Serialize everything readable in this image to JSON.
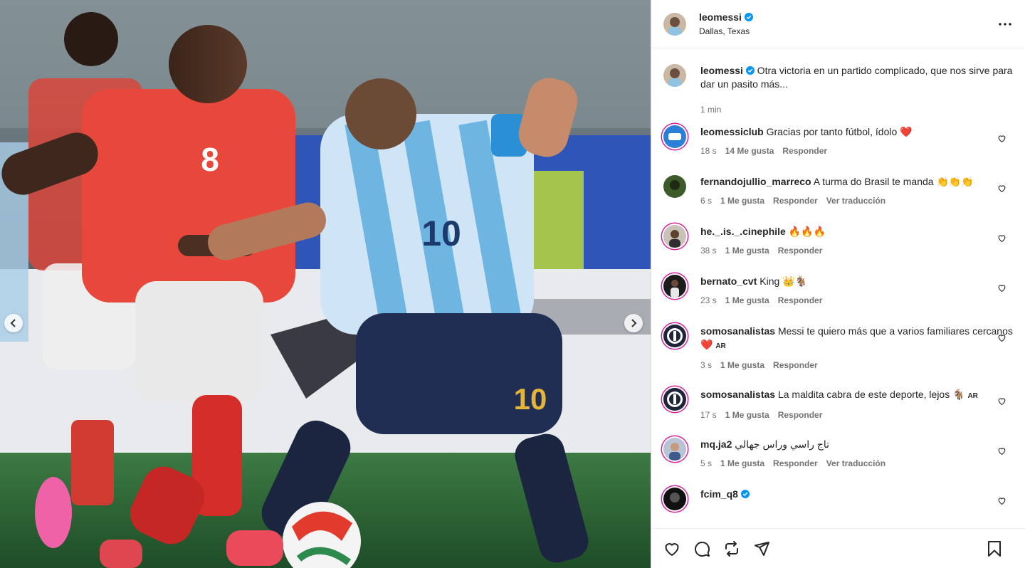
{
  "post": {
    "username": "leomessi",
    "location": "Dallas, Texas",
    "caption": "Otra victoria en un partido complicado, que nos sirve para dar un pasito más...",
    "time": "1 min"
  },
  "photo": {
    "jersey_number_left": "8",
    "jersey_number_right": "10",
    "shorts_number": "10"
  },
  "comments": [
    {
      "user": "leomessiclub",
      "text": "Gracias por tanto fútbol, ídolo ❤️",
      "time": "18 s",
      "likes": "14 Me gusta",
      "reply": "Responder",
      "translate": ""
    },
    {
      "user": "fernandojullio_marreco",
      "text": "A turma do Brasil te manda 👏👏👏",
      "time": "6 s",
      "likes": "1 Me gusta",
      "reply": "Responder",
      "translate": "Ver traducción"
    },
    {
      "user": "he._.is._.cinephile",
      "text": "🔥🔥🔥",
      "time": "38 s",
      "likes": "1 Me gusta",
      "reply": "Responder",
      "translate": ""
    },
    {
      "user": "bernato_cvt",
      "text": "King 👑🐐",
      "time": "23 s",
      "likes": "1 Me gusta",
      "reply": "Responder",
      "translate": ""
    },
    {
      "user": "somosanalistas",
      "text": "Messi te quiero más que a varios familiares cercanos ❤️",
      "ar": "AR",
      "time": "3 s",
      "likes": "1 Me gusta",
      "reply": "Responder",
      "translate": ""
    },
    {
      "user": "somosanalistas",
      "text": "La maldita cabra de este deporte, lejos 🐐",
      "ar": "AR",
      "time": "17 s",
      "likes": "1 Me gusta",
      "reply": "Responder",
      "translate": ""
    },
    {
      "user": "mq.ja2",
      "text": "تاج راسي وراس جهالي",
      "time": "5 s",
      "likes": "1 Me gusta",
      "reply": "Responder",
      "translate": "Ver traducción"
    },
    {
      "user": "fcim_q8",
      "text": "",
      "time": "",
      "likes": "",
      "reply": "",
      "translate": ""
    }
  ],
  "icons": {
    "like": "heart-icon",
    "comment": "comment-icon",
    "share": "repost-icon",
    "send": "send-icon",
    "save": "bookmark-icon",
    "more": "more-icon",
    "verified": "verified-badge-icon"
  },
  "colors": {
    "verified": "#0095f6",
    "heart_red": "#ed4956",
    "story_ring": "#d6249f"
  }
}
